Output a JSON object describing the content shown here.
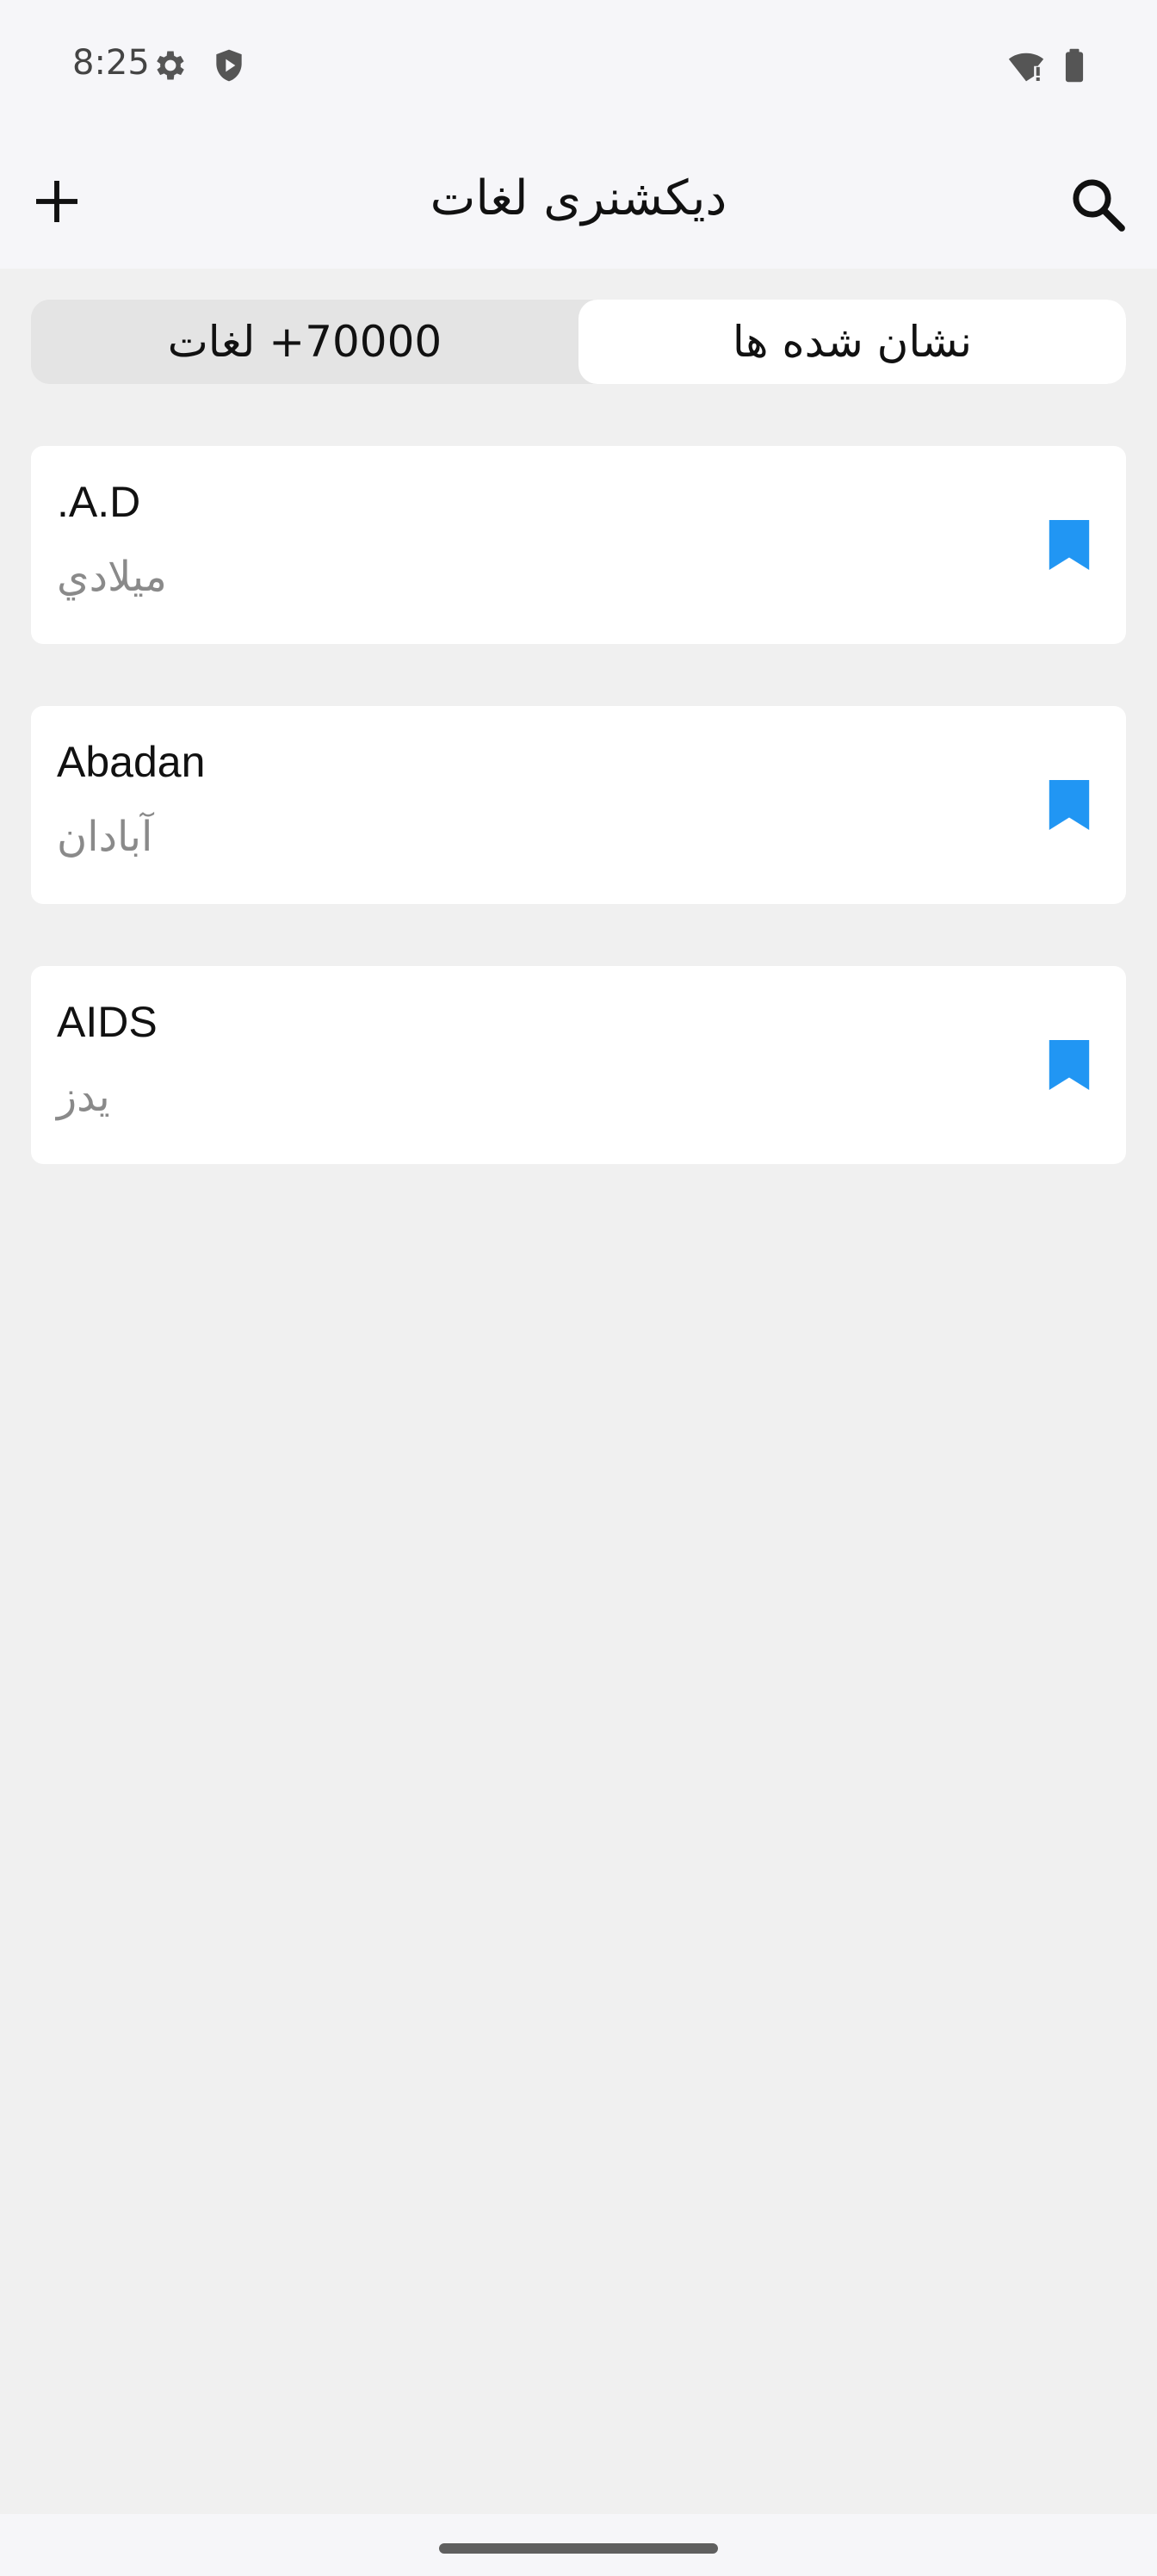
{
  "status_bar": {
    "time": "8:25",
    "icons": [
      "gear-icon",
      "shield-play-icon",
      "wifi-alert-icon",
      "battery-icon"
    ]
  },
  "app_bar": {
    "title": "دیکشنری لغات",
    "left_icon": "plus-icon",
    "right_icon": "search-icon"
  },
  "tabs": {
    "all_words": "70000+ لغات",
    "bookmarked": "نشان شده ها",
    "selected": "bookmarked"
  },
  "colors": {
    "bookmark": "#2196f3",
    "background": "#f0f0f0",
    "card": "#ffffff",
    "meaning_text": "#8a8a8a"
  },
  "items": [
    {
      "word": ".A.D",
      "meaning": "ميلادي",
      "icon": "bookmark-icon"
    },
    {
      "word": "Abadan",
      "meaning": "آبادان",
      "icon": "bookmark-icon"
    },
    {
      "word": "AIDS",
      "meaning": "يدز",
      "icon": "bookmark-icon"
    }
  ]
}
